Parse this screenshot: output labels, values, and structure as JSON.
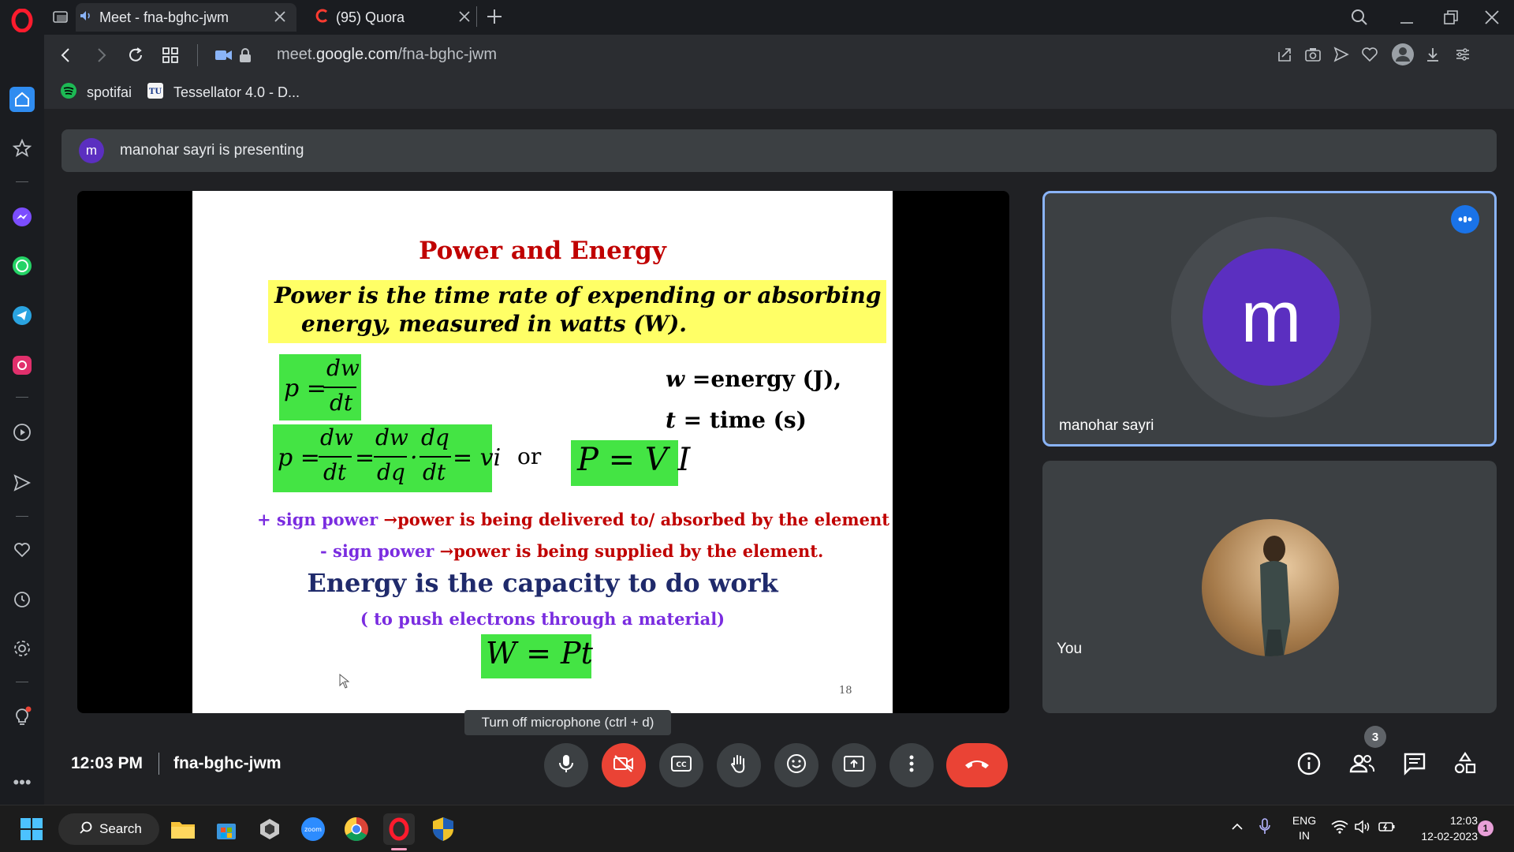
{
  "browser": {
    "tabs": [
      {
        "title": "Meet - fna-bghc-jwm",
        "active": true
      },
      {
        "title": "(95) Quora",
        "active": false
      }
    ],
    "url": {
      "prefix": "meet.",
      "domain": "google.com",
      "path": "/fna-bghc-jwm"
    },
    "bookmarks": [
      {
        "label": "spotifai",
        "icon": "spotify-icon"
      },
      {
        "label": "Tessellator 4.0 - D...",
        "icon": "tu-logo-icon"
      }
    ]
  },
  "meet": {
    "presenter_initial": "m",
    "presenting_text": "manohar sayri is presenting",
    "participants": [
      {
        "name": "manohar sayri",
        "initial": "m",
        "avatar_color": "#5b2fc0"
      },
      {
        "name": "You"
      }
    ],
    "time": "12:03 PM",
    "meeting_code": "fna-bghc-jwm",
    "tooltip": "Turn off microphone (ctrl + d)",
    "people_count": "3"
  },
  "slide": {
    "title": "Power and Energy",
    "definition_line1": "Power is the time rate of expending or absorbing",
    "definition_line2": "energy, measured in watts (W).",
    "formula1_lhs": "p =",
    "formula1_num": "dw",
    "formula1_den": "dt",
    "formula2_p": "p =",
    "formula2_f1_num": "dw",
    "formula2_f1_den": "dt",
    "formula2_eq": "=",
    "formula2_f2_num": "dw",
    "formula2_f2_den": "dq",
    "formula2_dot": "·",
    "formula2_f3_num": "dq",
    "formula2_f3_den": "dt",
    "formula2_tail": "= vi",
    "or_text": "or",
    "pvi": "P = V I",
    "w_def_var": "w",
    "w_def": " =energy (J),",
    "t_def_var": "t",
    "t_def": " = time (s)",
    "plus_sign_part": "+ sign power ",
    "plus_arrow": "→",
    "plus_desc": "power is being delivered to/ absorbed by the element",
    "minus_sign_part": "- sign power ",
    "minus_arrow": "→",
    "minus_desc": "power is being supplied by the element.",
    "energy_heading": "Energy is the capacity to do work",
    "energy_sub": "( to push electrons through a material)",
    "wpt": "W = Pt",
    "page_number": "18"
  },
  "taskbar": {
    "search_label": "Search",
    "lang_line1": "ENG",
    "lang_line2": "IN",
    "clock_time": "12:03",
    "clock_date": "12-02-2023",
    "notification_count": "1"
  },
  "colors": {
    "accent_blue": "#8ab4f8",
    "hangup_red": "#ea4335",
    "slide_green": "#44e444",
    "slide_yellow": "#ffff66",
    "slide_red": "#c00000",
    "slide_purple": "#7a2ce0",
    "slide_navy": "#1f2a6b"
  }
}
